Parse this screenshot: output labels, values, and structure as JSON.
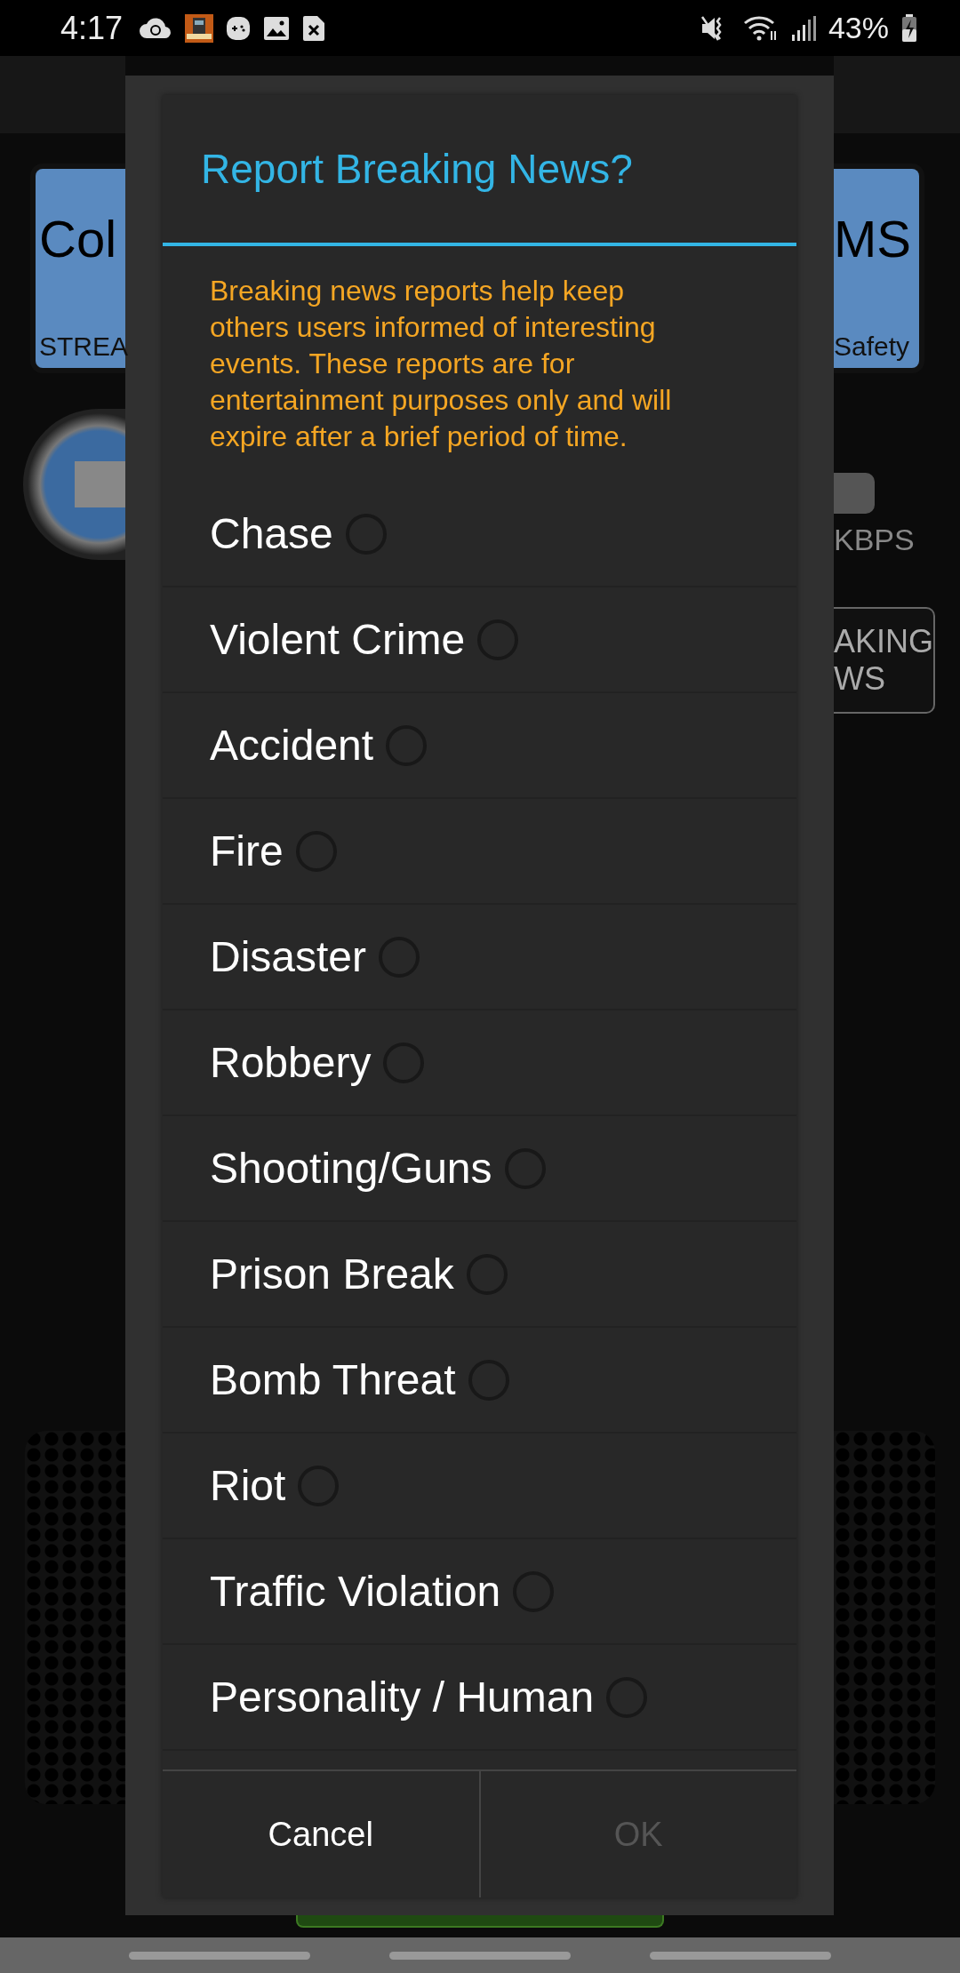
{
  "status_bar": {
    "time": "4:17",
    "battery": "43%"
  },
  "background": {
    "left_panel": {
      "title": "Col",
      "subtitle": "STREA"
    },
    "right_panel": {
      "title": "MS",
      "subtitle": "Safety"
    },
    "rate_label": "KBPS",
    "news_button": [
      "AKING",
      "WS"
    ]
  },
  "dialog": {
    "title": "Report Breaking News?",
    "message": "Breaking news reports help keep others users informed of interesting events. These reports are for entertainment purposes only and will expire after a brief period of time.",
    "options": [
      {
        "label": "Chase",
        "selected": false
      },
      {
        "label": "Violent Crime",
        "selected": false
      },
      {
        "label": "Accident",
        "selected": false
      },
      {
        "label": "Fire",
        "selected": false
      },
      {
        "label": "Disaster",
        "selected": false
      },
      {
        "label": "Robbery",
        "selected": false
      },
      {
        "label": "Shooting/Guns",
        "selected": false
      },
      {
        "label": "Prison Break",
        "selected": false
      },
      {
        "label": "Bomb Threat",
        "selected": false
      },
      {
        "label": "Riot",
        "selected": false
      },
      {
        "label": "Traffic Violation",
        "selected": false
      },
      {
        "label": "Personality / Human",
        "selected": false
      }
    ],
    "buttons": [
      {
        "label": "Cancel",
        "disabled": false
      },
      {
        "label": "OK",
        "disabled": true
      }
    ]
  }
}
